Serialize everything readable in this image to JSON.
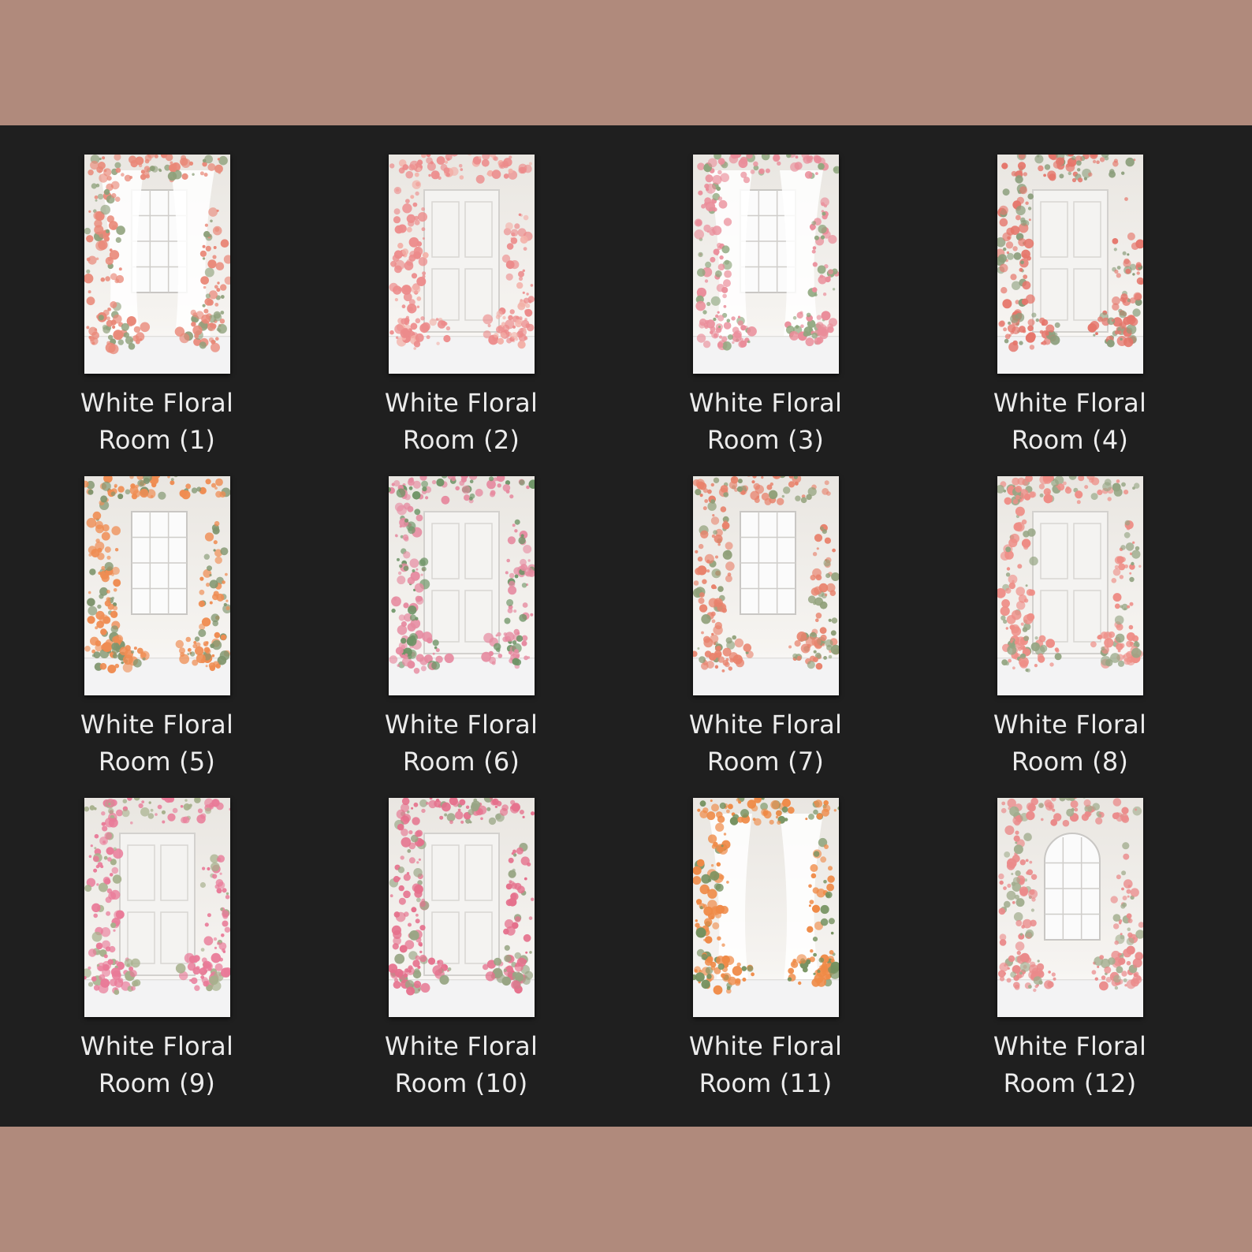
{
  "colors": {
    "frame_band": "#b08a7c",
    "explorer_background": "#1f1f1f",
    "label_text": "#ececec"
  },
  "files": [
    {
      "name_line1": "White Floral",
      "name_line2": "Room (1)",
      "scene": "window-curtain",
      "flower": "#e98878",
      "accent": "#8ea07a"
    },
    {
      "name_line1": "White Floral",
      "name_line2": "Room (2)",
      "scene": "door",
      "flower": "#ec8b8b",
      "accent": "#f3b0a8"
    },
    {
      "name_line1": "White Floral",
      "name_line2": "Room (3)",
      "scene": "window-curtain",
      "flower": "#ea8d9a",
      "accent": "#8fa77e"
    },
    {
      "name_line1": "White Floral",
      "name_line2": "Room (4)",
      "scene": "panel",
      "flower": "#e5766b",
      "accent": "#8c9e7c"
    },
    {
      "name_line1": "White Floral",
      "name_line2": "Room (5)",
      "scene": "window",
      "flower": "#ef8c52",
      "accent": "#7f956d"
    },
    {
      "name_line1": "White Floral",
      "name_line2": "Room (6)",
      "scene": "door",
      "flower": "#e68aa0",
      "accent": "#6e9466"
    },
    {
      "name_line1": "White Floral",
      "name_line2": "Room (7)",
      "scene": "window",
      "flower": "#e8826c",
      "accent": "#8f9f78"
    },
    {
      "name_line1": "White Floral",
      "name_line2": "Room (8)",
      "scene": "panel",
      "flower": "#ee8d86",
      "accent": "#95a583"
    },
    {
      "name_line1": "White Floral",
      "name_line2": "Room (9)",
      "scene": "door",
      "flower": "#e97a98",
      "accent": "#a6b08c"
    },
    {
      "name_line1": "White Floral",
      "name_line2": "Room (10)",
      "scene": "panel",
      "flower": "#e5708c",
      "accent": "#98a584"
    },
    {
      "name_line1": "White Floral",
      "name_line2": "Room (11)",
      "scene": "curtain",
      "flower": "#ef8a47",
      "accent": "#75915f"
    },
    {
      "name_line1": "White Floral",
      "name_line2": "Room (12)",
      "scene": "arch-window",
      "flower": "#ea8a8a",
      "accent": "#a2ad8e"
    }
  ]
}
